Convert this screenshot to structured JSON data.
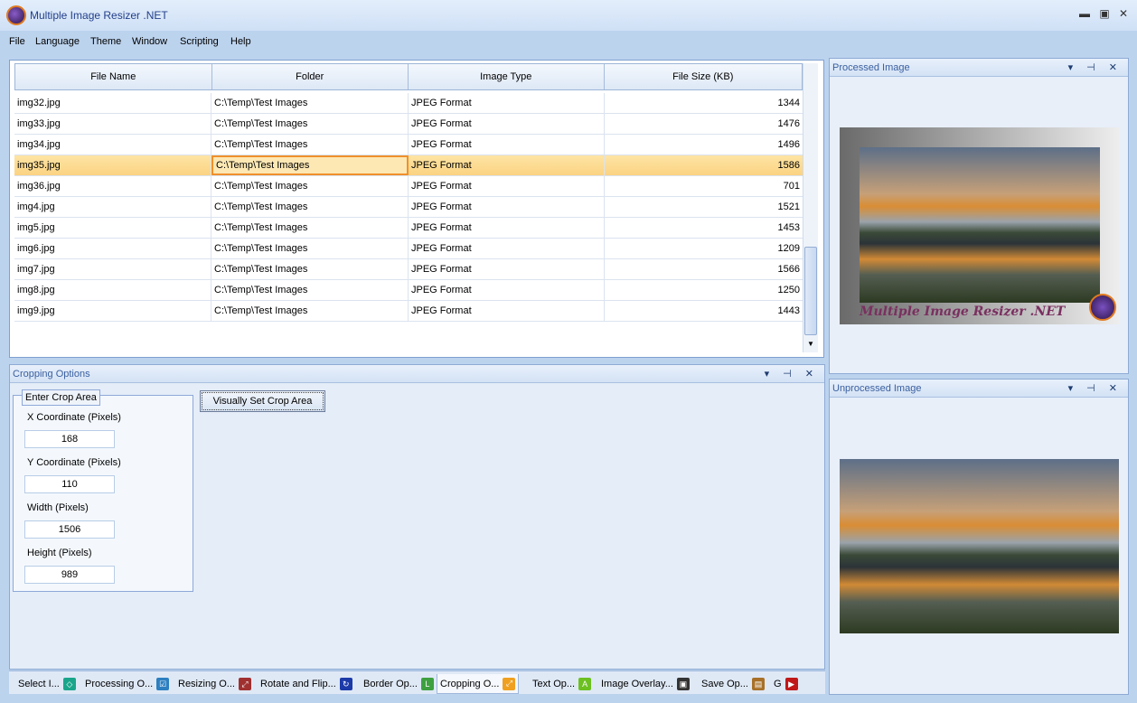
{
  "window": {
    "title": "Multiple Image Resizer .NET",
    "min": "▬",
    "max": "▣",
    "close": "✕"
  },
  "menu": [
    "File",
    "Language",
    "Theme",
    "Window",
    "Scripting",
    "Help"
  ],
  "grid": {
    "columns": [
      "File Name",
      "Folder",
      "Image Type",
      "File Size (KB)"
    ],
    "rows": [
      [
        "img32.jpg",
        "C:\\Temp\\Test Images",
        "JPEG Format",
        "1344"
      ],
      [
        "img33.jpg",
        "C:\\Temp\\Test Images",
        "JPEG Format",
        "1476"
      ],
      [
        "img34.jpg",
        "C:\\Temp\\Test Images",
        "JPEG Format",
        "1496"
      ],
      [
        "img35.jpg",
        "C:\\Temp\\Test Images",
        "JPEG Format",
        "1586"
      ],
      [
        "img36.jpg",
        "C:\\Temp\\Test Images",
        "JPEG Format",
        "701"
      ],
      [
        "img4.jpg",
        "C:\\Temp\\Test Images",
        "JPEG Format",
        "1521"
      ],
      [
        "img5.jpg",
        "C:\\Temp\\Test Images",
        "JPEG Format",
        "1453"
      ],
      [
        "img6.jpg",
        "C:\\Temp\\Test Images",
        "JPEG Format",
        "1209"
      ],
      [
        "img7.jpg",
        "C:\\Temp\\Test Images",
        "JPEG Format",
        "1566"
      ],
      [
        "img8.jpg",
        "C:\\Temp\\Test Images",
        "JPEG Format",
        "1250"
      ],
      [
        "img9.jpg",
        "C:\\Temp\\Test Images",
        "JPEG Format",
        "1443"
      ]
    ],
    "selected_index": 3
  },
  "crop": {
    "title": "Cropping Options",
    "group": "Enter Crop Area",
    "x_label": "X Coordinate (Pixels)",
    "x": "168",
    "y_label": "Y Coordinate (Pixels)",
    "y": "110",
    "w_label": "Width (Pixels)",
    "w": "1506",
    "h_label": "Height (Pixels)",
    "h": "989",
    "visual_button": "Visually Set Crop Area"
  },
  "panes": {
    "processed": "Processed Image",
    "unprocessed": "Unprocessed Image",
    "icons": "▾ ⊣ ✕",
    "watermark": "Multiple Image Resizer .NET"
  },
  "tabs": [
    {
      "label": "Select I...",
      "color": "#1aa58a",
      "glyph": "◇"
    },
    {
      "label": "Processing O...",
      "color": "#2d7fc0",
      "glyph": "☑"
    },
    {
      "label": "Resizing O...",
      "color": "#a03030",
      "glyph": "⤢"
    },
    {
      "label": "Rotate and Flip...",
      "color": "#1c3aa8",
      "glyph": "↻"
    },
    {
      "label": "Border Op...",
      "color": "#3fa040",
      "glyph": "L"
    },
    {
      "label": "Cropping O...",
      "color": "#f0a020",
      "glyph": "⤢"
    },
    {
      "label": "Text Op...",
      "color": "#6cc020",
      "glyph": "A"
    },
    {
      "label": "Image Overlay...",
      "color": "#333333",
      "glyph": "▣"
    },
    {
      "label": "Save Op...",
      "color": "#a87028",
      "glyph": "▤"
    },
    {
      "label": "G",
      "color": "#c01818",
      "glyph": "▶"
    }
  ]
}
